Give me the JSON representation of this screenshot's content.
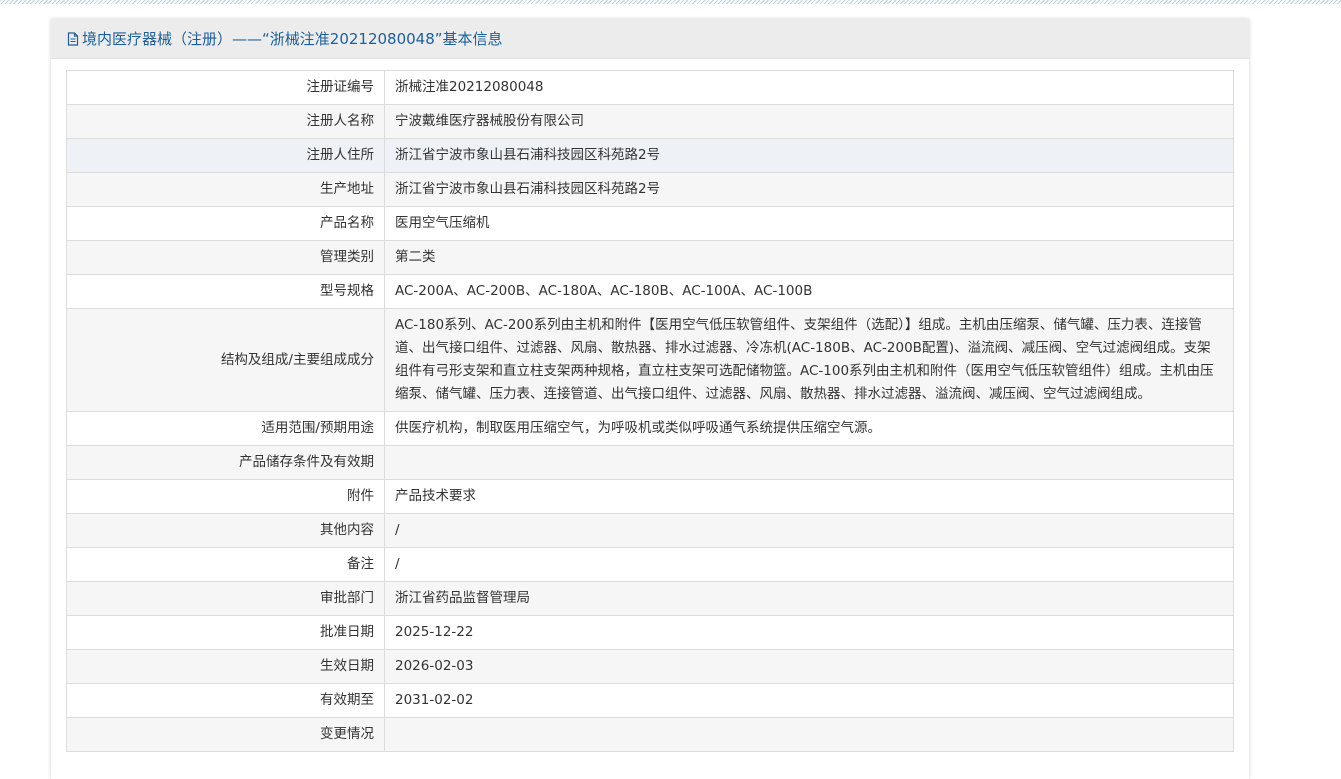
{
  "header": {
    "title": "境内医疗器械（注册）——“浙械注准20212080048”基本信息",
    "icon": "document-icon"
  },
  "rows": [
    {
      "label": "注册证编号",
      "value": "浙械注准20212080048"
    },
    {
      "label": "注册人名称",
      "value": "宁波戴维医疗器械股份有限公司"
    },
    {
      "label": "注册人住所",
      "value": "浙江省宁波市象山县石浦科技园区科苑路2号"
    },
    {
      "label": "生产地址",
      "value": "浙江省宁波市象山县石浦科技园区科苑路2号"
    },
    {
      "label": "产品名称",
      "value": "医用空气压缩机"
    },
    {
      "label": "管理类别",
      "value": "第二类"
    },
    {
      "label": "型号规格",
      "value": "AC-200A、AC-200B、AC-180A、AC-180B、AC-100A、AC-100B"
    },
    {
      "label": "结构及组成/主要组成成分",
      "value": "AC-180系列、AC-200系列由主机和附件【医用空气低压软管组件、支架组件（选配）】组成。主机由压缩泵、储气罐、压力表、连接管道、出气接口组件、过滤器、风扇、散热器、排水过滤器、冷冻机(AC-180B、AC-200B配置)、溢流阀、减压阀、空气过滤阀组成。支架组件有弓形支架和直立柱支架两种规格，直立柱支架可选配储物篮。AC-100系列由主机和附件（医用空气低压软管组件）组成。主机由压缩泵、储气罐、压力表、连接管道、出气接口组件、过滤器、风扇、散热器、排水过滤器、溢流阀、减压阀、空气过滤阀组成。"
    },
    {
      "label": "适用范围/预期用途",
      "value": "供医疗机构，制取医用压缩空气，为呼吸机或类似呼吸通气系统提供压缩空气源。"
    },
    {
      "label": "产品储存条件及有效期",
      "value": ""
    },
    {
      "label": "附件",
      "value": "产品技术要求"
    },
    {
      "label": "其他内容",
      "value": "/"
    },
    {
      "label": "备注",
      "value": "/"
    },
    {
      "label": "审批部门",
      "value": "浙江省药品监督管理局"
    },
    {
      "label": "批准日期",
      "value": "2025-12-22"
    },
    {
      "label": "生效日期",
      "value": "2026-02-03"
    },
    {
      "label": "有效期至",
      "value": "2031-02-02"
    },
    {
      "label": "变更情况",
      "value": ""
    }
  ]
}
